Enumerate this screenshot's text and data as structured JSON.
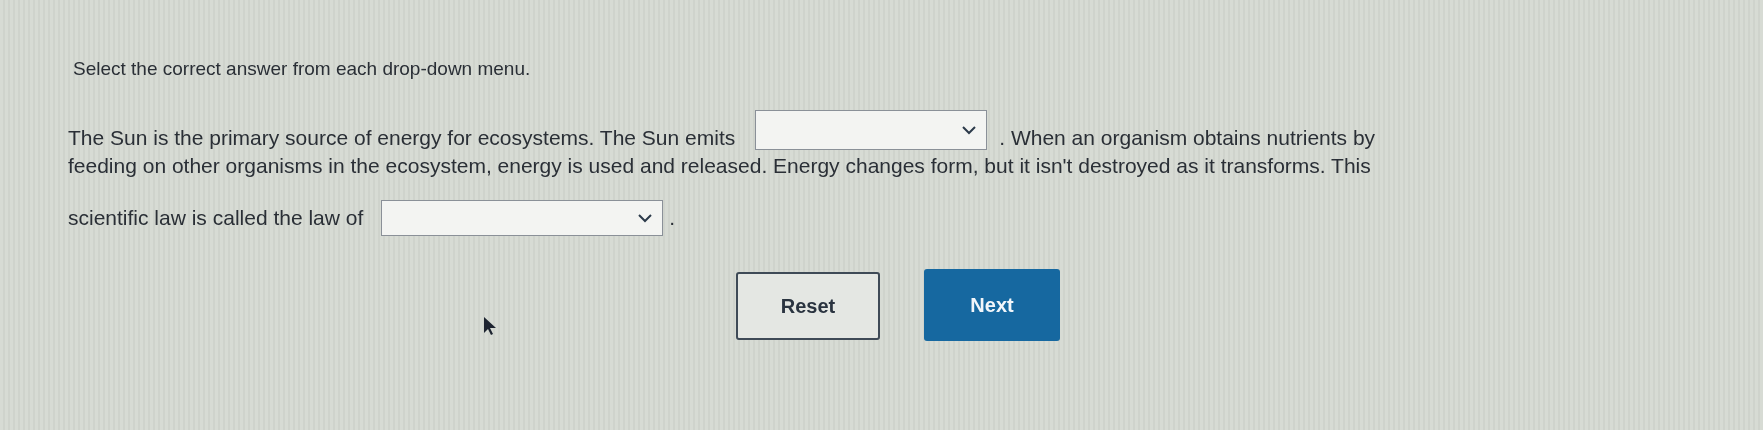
{
  "instruction": "Select the correct answer from each drop-down menu.",
  "lines": [
    [
      {
        "kind": "text",
        "text": "The Sun is the primary source of energy for ecosystems. The Sun emits"
      },
      {
        "kind": "dropdown"
      },
      {
        "kind": "text",
        "text": ". When an organism obtains nutrients by"
      }
    ],
    [
      {
        "kind": "text",
        "text": "feeding on other organisms in the ecosystem, energy is used and released. Energy changes form, but it isn't destroyed as it transforms. This"
      }
    ],
    [
      {
        "kind": "text",
        "text": "scientific law is called the law of"
      },
      {
        "kind": "dropdown"
      },
      {
        "kind": "text",
        "text": "."
      }
    ]
  ],
  "buttons": [
    {
      "label": "Reset",
      "kind": "secondary"
    },
    {
      "label": "Next",
      "kind": "primary"
    }
  ]
}
